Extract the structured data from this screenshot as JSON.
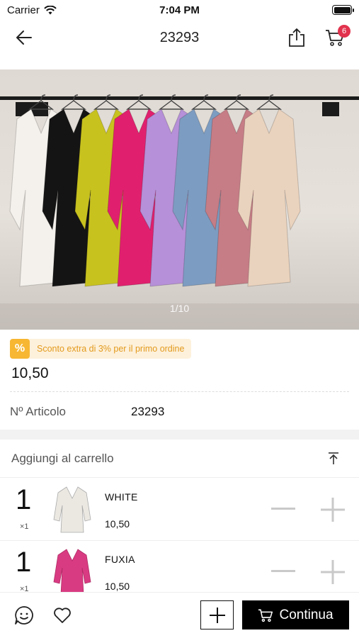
{
  "status_bar": {
    "carrier": "Carrier",
    "time": "7:04 PM"
  },
  "nav": {
    "title": "23293",
    "cart_count": "6"
  },
  "hero": {
    "counter": "1/10",
    "dress_colors": [
      "#f4f1ec",
      "#141414",
      "#c8c21f",
      "#e0206e",
      "#b690d8",
      "#7d9cc1",
      "#c67d86",
      "#ead3be"
    ]
  },
  "promo": {
    "icon": "%",
    "text": "Sconto extra di 3% per il primo ordine"
  },
  "price": "10,50",
  "sku": {
    "label": "Nº Articolo",
    "value": "23293"
  },
  "cart_section": {
    "title": "Aggiungi al carrello"
  },
  "variants": [
    {
      "qty": "1",
      "mult": "×1",
      "name": "WHITE",
      "price": "10,50",
      "color": "#ebe8e2"
    },
    {
      "qty": "1",
      "mult": "×1",
      "name": "FUXIA",
      "price": "10,50",
      "color": "#d93b82"
    }
  ],
  "bottom": {
    "continue_label": "Continua"
  }
}
